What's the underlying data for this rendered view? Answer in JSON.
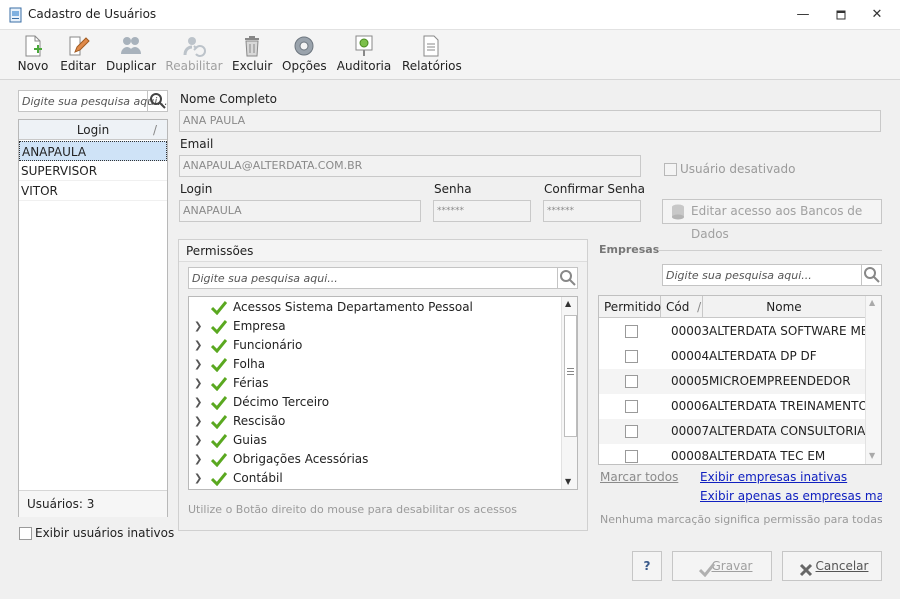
{
  "window": {
    "title": "Cadastro de Usuários"
  },
  "toolbar": {
    "novo": "Novo",
    "editar": "Editar",
    "duplicar": "Duplicar",
    "reabilitar": "Reabilitar",
    "excluir": "Excluir",
    "opcoes": "Opções",
    "auditoria": "Auditoria",
    "relatorios": "Relatórios"
  },
  "users": {
    "search_placeholder": "Digite sua pesquisa aqui...",
    "column_header": "Login",
    "sort_glyph": "/",
    "items": [
      "ANAPAULA",
      "SUPERVISOR",
      "VITOR"
    ],
    "selected": "ANAPAULA",
    "count_label": "Usuários: 3",
    "show_inactive_label": "Exibir usuários inativos"
  },
  "form": {
    "nome_label": "Nome Completo",
    "nome_value": "ANA PAULA",
    "email_label": "Email",
    "email_value": "ANAPAULA@ALTERDATA.COM.BR",
    "login_label": "Login",
    "login_value": "ANAPAULA",
    "senha_label": "Senha",
    "senha_value": "******",
    "confirmar_label": "Confirmar Senha",
    "confirmar_value": "******",
    "desativado_label": "Usuário desativado",
    "db_access_button": "Editar acesso aos Bancos de Dados"
  },
  "permissions": {
    "title": "Permissões",
    "search_placeholder": "Digite sua pesquisa aqui...",
    "items": [
      "Acessos Sistema Departamento Pessoal",
      "Empresa",
      "Funcionário",
      "Folha",
      "Férias",
      "Décimo Terceiro",
      "Rescisão",
      "Guias",
      "Obrigações Acessórias",
      "Contábil"
    ],
    "hint": "Utilize o Botão direito do mouse para desabilitar os acessos"
  },
  "empresas": {
    "title": "Empresas",
    "search_placeholder": "Digite sua pesquisa aqui...",
    "columns": {
      "permitido": "Permitido",
      "cod": "Cód",
      "cod_sort": "/",
      "nome": "Nome"
    },
    "rows": [
      {
        "cod": "00003",
        "nome": "ALTERDATA SOFTWARE ME"
      },
      {
        "cod": "00004",
        "nome": "ALTERDATA DP  DF"
      },
      {
        "cod": "00005",
        "nome": "MICROEMPREENDEDOR"
      },
      {
        "cod": "00006",
        "nome": "ALTERDATA TREINAMENTO"
      },
      {
        "cod": "00007",
        "nome": "ALTERDATA CONSULTORIA"
      },
      {
        "cod": "00008",
        "nome": "ALTERDATA TEC EM"
      }
    ],
    "marcar_todos": "Marcar todos",
    "exibir_inativas": "Exibir empresas inativas",
    "exibir_marcadas": "Exibir apenas as empresas marcadas",
    "hint": "Nenhuma marcação significa permissão para todas as"
  },
  "footer": {
    "help": "?",
    "gravar": "Gravar",
    "cancelar": "Cancelar"
  },
  "colors": {
    "selection": "#cfe3f7",
    "check_green": "#5aa820",
    "link": "#1020c0"
  }
}
